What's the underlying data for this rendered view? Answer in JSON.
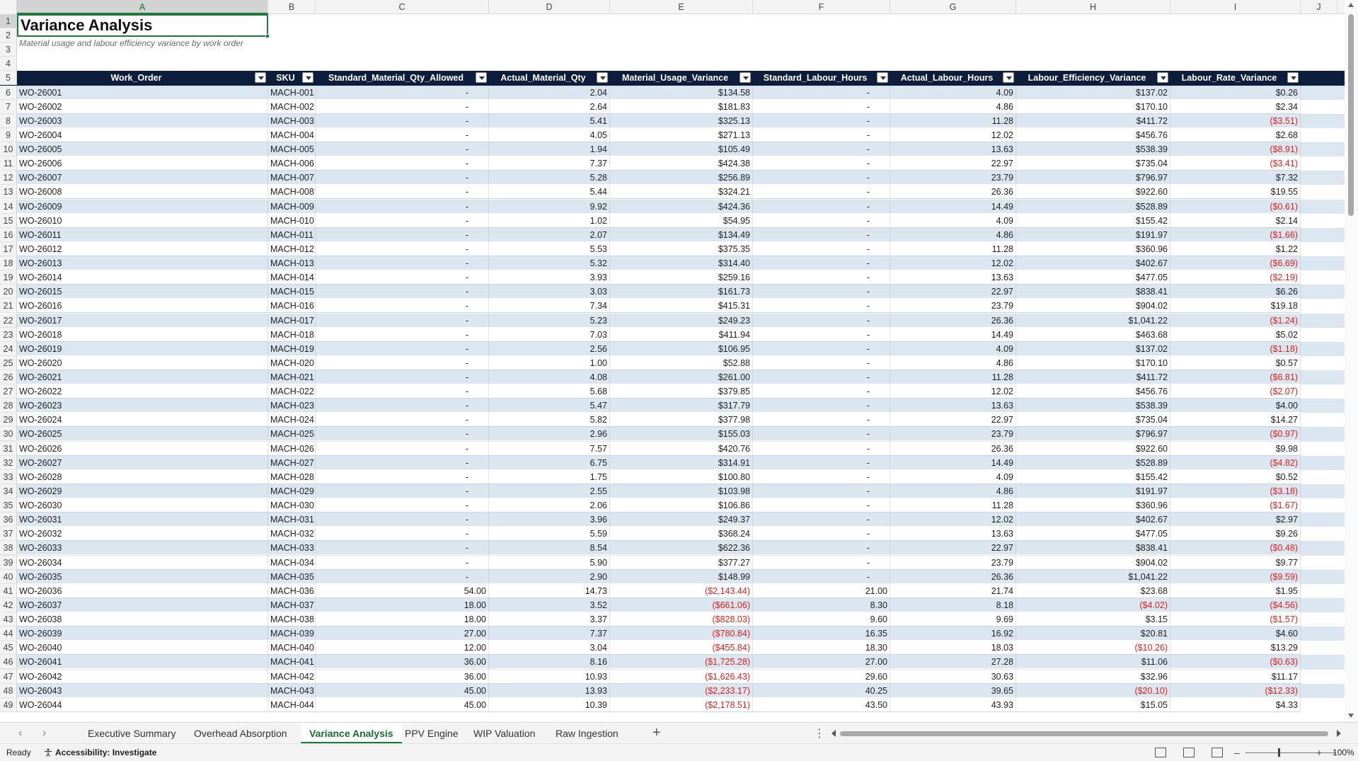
{
  "sheet": {
    "title": "Variance Analysis",
    "subtitle": "Material usage and labour efficiency variance by work order",
    "column_letters": [
      "A",
      "B",
      "C",
      "D",
      "E",
      "F",
      "G",
      "H",
      "I",
      "J"
    ],
    "headers": [
      "Work_Order",
      "SKU",
      "Standard_Material_Qty_Allowed",
      "Actual_Material_Qty",
      "Material_Usage_Variance",
      "Standard_Labour_Hours",
      "Actual_Labour_Hours",
      "Labour_Efficiency_Variance",
      "Labour_Rate_Variance"
    ],
    "rows": [
      [
        "WO-26001",
        "MACH-001",
        "-",
        "2.04",
        "$134.58",
        "-",
        "4.09",
        "$137.02",
        "$0.26"
      ],
      [
        "WO-26002",
        "MACH-002",
        "-",
        "2.64",
        "$181.83",
        "-",
        "4.86",
        "$170.10",
        "$2.34"
      ],
      [
        "WO-26003",
        "MACH-003",
        "-",
        "5.41",
        "$325.13",
        "-",
        "11.28",
        "$411.72",
        "($3.51)"
      ],
      [
        "WO-26004",
        "MACH-004",
        "-",
        "4.05",
        "$271.13",
        "-",
        "12.02",
        "$456.76",
        "$2.68"
      ],
      [
        "WO-26005",
        "MACH-005",
        "-",
        "1.94",
        "$105.49",
        "-",
        "13.63",
        "$538.39",
        "($8.91)"
      ],
      [
        "WO-26006",
        "MACH-006",
        "-",
        "7.37",
        "$424.38",
        "-",
        "22.97",
        "$735.04",
        "($3.41)"
      ],
      [
        "WO-26007",
        "MACH-007",
        "-",
        "5.28",
        "$256.89",
        "-",
        "23.79",
        "$796.97",
        "$7.32"
      ],
      [
        "WO-26008",
        "MACH-008",
        "-",
        "5.44",
        "$324.21",
        "-",
        "26.36",
        "$922.60",
        "$19.55"
      ],
      [
        "WO-26009",
        "MACH-009",
        "-",
        "9.92",
        "$424.36",
        "-",
        "14.49",
        "$528.89",
        "($0.61)"
      ],
      [
        "WO-26010",
        "MACH-010",
        "-",
        "1.02",
        "$54.95",
        "-",
        "4.09",
        "$155.42",
        "$2.14"
      ],
      [
        "WO-26011",
        "MACH-011",
        "-",
        "2.07",
        "$134.49",
        "-",
        "4.86",
        "$191.97",
        "($1.66)"
      ],
      [
        "WO-26012",
        "MACH-012",
        "-",
        "5.53",
        "$375.35",
        "-",
        "11.28",
        "$360.96",
        "$1.22"
      ],
      [
        "WO-26013",
        "MACH-013",
        "-",
        "5.32",
        "$314.40",
        "-",
        "12.02",
        "$402.67",
        "($6.69)"
      ],
      [
        "WO-26014",
        "MACH-014",
        "-",
        "3.93",
        "$259.16",
        "-",
        "13.63",
        "$477.05",
        "($2.19)"
      ],
      [
        "WO-26015",
        "MACH-015",
        "-",
        "3.03",
        "$161.73",
        "-",
        "22.97",
        "$838.41",
        "$6.26"
      ],
      [
        "WO-26016",
        "MACH-016",
        "-",
        "7.34",
        "$415.31",
        "-",
        "23.79",
        "$904.02",
        "$19.18"
      ],
      [
        "WO-26017",
        "MACH-017",
        "-",
        "5.23",
        "$249.23",
        "-",
        "26.36",
        "$1,041.22",
        "($1.24)"
      ],
      [
        "WO-26018",
        "MACH-018",
        "-",
        "7.03",
        "$411.94",
        "-",
        "14.49",
        "$463.68",
        "$5.02"
      ],
      [
        "WO-26019",
        "MACH-019",
        "-",
        "2.56",
        "$106.95",
        "-",
        "4.09",
        "$137.02",
        "($1.18)"
      ],
      [
        "WO-26020",
        "MACH-020",
        "-",
        "1.00",
        "$52.88",
        "-",
        "4.86",
        "$170.10",
        "$0.57"
      ],
      [
        "WO-26021",
        "MACH-021",
        "-",
        "4.08",
        "$261.00",
        "-",
        "11.28",
        "$411.72",
        "($6.81)"
      ],
      [
        "WO-26022",
        "MACH-022",
        "-",
        "5.68",
        "$379.85",
        "-",
        "12.02",
        "$456.76",
        "($2.07)"
      ],
      [
        "WO-26023",
        "MACH-023",
        "-",
        "5.47",
        "$317.79",
        "-",
        "13.63",
        "$538.39",
        "$4.00"
      ],
      [
        "WO-26024",
        "MACH-024",
        "-",
        "5.82",
        "$377.98",
        "-",
        "22.97",
        "$735.04",
        "$14.27"
      ],
      [
        "WO-26025",
        "MACH-025",
        "-",
        "2.96",
        "$155.03",
        "-",
        "23.79",
        "$796.97",
        "($0.97)"
      ],
      [
        "WO-26026",
        "MACH-026",
        "-",
        "7.57",
        "$420.76",
        "-",
        "26.36",
        "$922.60",
        "$9.98"
      ],
      [
        "WO-26027",
        "MACH-027",
        "-",
        "6.75",
        "$314.91",
        "-",
        "14.49",
        "$528.89",
        "($4.82)"
      ],
      [
        "WO-26028",
        "MACH-028",
        "-",
        "1.75",
        "$100.80",
        "-",
        "4.09",
        "$155.42",
        "$0.52"
      ],
      [
        "WO-26029",
        "MACH-029",
        "-",
        "2.55",
        "$103.98",
        "-",
        "4.86",
        "$191.97",
        "($3.18)"
      ],
      [
        "WO-26030",
        "MACH-030",
        "-",
        "2.06",
        "$106.86",
        "-",
        "11.28",
        "$360.96",
        "($1.67)"
      ],
      [
        "WO-26031",
        "MACH-031",
        "-",
        "3.96",
        "$249.37",
        "-",
        "12.02",
        "$402.67",
        "$2.97"
      ],
      [
        "WO-26032",
        "MACH-032",
        "-",
        "5.59",
        "$368.24",
        "-",
        "13.63",
        "$477.05",
        "$9.26"
      ],
      [
        "WO-26033",
        "MACH-033",
        "-",
        "8.54",
        "$622.36",
        "-",
        "22.97",
        "$838.41",
        "($0.48)"
      ],
      [
        "WO-26034",
        "MACH-034",
        "-",
        "5.90",
        "$377.27",
        "-",
        "23.79",
        "$904.02",
        "$9.77"
      ],
      [
        "WO-26035",
        "MACH-035",
        "-",
        "2.90",
        "$148.99",
        "-",
        "26.36",
        "$1,041.22",
        "($9.59)"
      ],
      [
        "WO-26036",
        "MACH-036",
        "54.00",
        "14.73",
        "($2,143.44)",
        "21.00",
        "21.74",
        "$23.68",
        "$1.95"
      ],
      [
        "WO-26037",
        "MACH-037",
        "18.00",
        "3.52",
        "($661.06)",
        "8.30",
        "8.18",
        "($4.02)",
        "($4.56)"
      ],
      [
        "WO-26038",
        "MACH-038",
        "18.00",
        "3.37",
        "($828.03)",
        "9.60",
        "9.69",
        "$3.15",
        "($1.57)"
      ],
      [
        "WO-26039",
        "MACH-039",
        "27.00",
        "7.37",
        "($780.84)",
        "16.35",
        "16.92",
        "$20.81",
        "$4.60"
      ],
      [
        "WO-26040",
        "MACH-040",
        "12.00",
        "3.04",
        "($455.84)",
        "18.30",
        "18.03",
        "($10.26)",
        "$13.29"
      ],
      [
        "WO-26041",
        "MACH-041",
        "36.00",
        "8.16",
        "($1,725.28)",
        "27.00",
        "27.28",
        "$11.06",
        "($0.63)"
      ],
      [
        "WO-26042",
        "MACH-042",
        "36.00",
        "10.93",
        "($1,626.43)",
        "29.60",
        "30.63",
        "$32.96",
        "$11.17"
      ],
      [
        "WO-26043",
        "MACH-043",
        "45.00",
        "13.93",
        "($2,233.17)",
        "40.25",
        "39.65",
        "($20.10)",
        "($12.33)"
      ],
      [
        "WO-26044",
        "MACH-044",
        "45.00",
        "10.39",
        "($2,178.51)",
        "43.50",
        "43.93",
        "$15.05",
        "$4.33"
      ]
    ]
  },
  "tabs": [
    "Executive Summary",
    "Overhead Absorption",
    "Variance Analysis",
    "PPV Engine",
    "WIP Valuation",
    "Raw Ingestion"
  ],
  "active_tab": "Variance Analysis",
  "status": {
    "ready": "Ready",
    "accessibility": "Accessibility: Investigate",
    "zoom": "100%"
  },
  "colors": {
    "header_fill": "#0e1d3c",
    "band_fill": "#dce6f1",
    "negative": "#e0201b",
    "selection": "#1e7a3c"
  },
  "icons": [
    "filter-dropdown-icon",
    "add-sheet-icon",
    "more-options-icon",
    "accessibility-icon",
    "normal-view-icon",
    "page-layout-icon",
    "page-break-icon"
  ]
}
